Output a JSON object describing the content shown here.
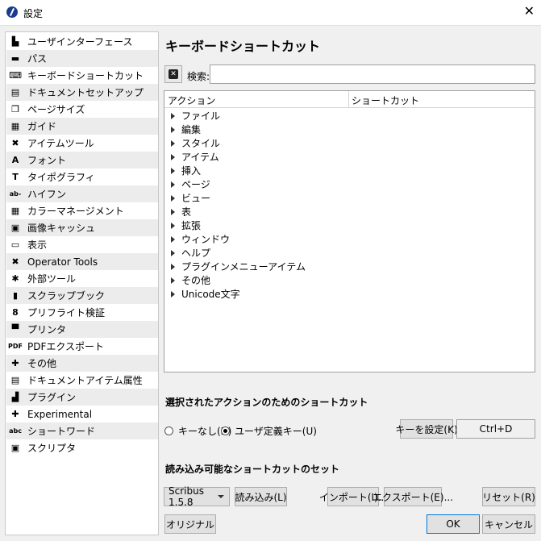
{
  "window": {
    "title": "設定",
    "close": "✕"
  },
  "sidebar": {
    "items": [
      {
        "label": "ユーザインターフェース",
        "icon": "user-interface-icon",
        "glyph": "▙"
      },
      {
        "label": "パス",
        "icon": "folder-icon",
        "glyph": "▬"
      },
      {
        "label": "キーボードショートカット",
        "icon": "keyboard-icon",
        "glyph": "⌨"
      },
      {
        "label": "ドキュメントセットアップ",
        "icon": "document-setup-icon",
        "glyph": "▤"
      },
      {
        "label": "ページサイズ",
        "icon": "page-size-icon",
        "glyph": "❐"
      },
      {
        "label": "ガイド",
        "icon": "guides-icon",
        "glyph": "▦"
      },
      {
        "label": "アイテムツール",
        "icon": "tools-icon",
        "glyph": "✖"
      },
      {
        "label": "フォント",
        "icon": "font-icon",
        "glyph": "A"
      },
      {
        "label": "タイポグラフィ",
        "icon": "typography-icon",
        "glyph": "T"
      },
      {
        "label": "ハイフン",
        "icon": "hyphenation-icon",
        "glyph": "ab-"
      },
      {
        "label": "カラーマネージメント",
        "icon": "color-management-icon",
        "glyph": "▦"
      },
      {
        "label": "画像キャッシュ",
        "icon": "image-cache-icon",
        "glyph": "▣"
      },
      {
        "label": "表示",
        "icon": "display-icon",
        "glyph": "▭"
      },
      {
        "label": "Operator Tools",
        "icon": "operator-tools-icon",
        "glyph": "✖"
      },
      {
        "label": "外部ツール",
        "icon": "external-tools-icon",
        "glyph": "✱"
      },
      {
        "label": "スクラップブック",
        "icon": "scrapbook-icon",
        "glyph": "▮"
      },
      {
        "label": "プリフライト検証",
        "icon": "preflight-icon",
        "glyph": "8"
      },
      {
        "label": "プリンタ",
        "icon": "printer-icon",
        "glyph": "▀"
      },
      {
        "label": "PDFエクスポート",
        "icon": "pdf-export-icon",
        "glyph": "PDF"
      },
      {
        "label": "その他",
        "icon": "misc-icon",
        "glyph": "✚"
      },
      {
        "label": "ドキュメントアイテム属性",
        "icon": "document-item-attributes-icon",
        "glyph": "▤"
      },
      {
        "label": "プラグイン",
        "icon": "plugins-icon",
        "glyph": "▟"
      },
      {
        "label": "Experimental",
        "icon": "experimental-icon",
        "glyph": "✚"
      },
      {
        "label": "ショートワード",
        "icon": "short-words-icon",
        "glyph": "abc"
      },
      {
        "label": "スクリプタ",
        "icon": "scripter-icon",
        "glyph": "▣"
      }
    ]
  },
  "main": {
    "heading": "キーボードショートカット",
    "search_label": "検索:",
    "search_value": "",
    "columns": {
      "action": "アクション",
      "shortcut": "ショートカット"
    },
    "tree": [
      "ファイル",
      "編集",
      "スタイル",
      "アイテム",
      "挿入",
      "ページ",
      "ビュー",
      "表",
      "拡張",
      "ウィンドウ",
      "ヘルプ",
      "プラグインメニューアイテム",
      "その他",
      "Unicode文字"
    ],
    "selected_section": "選択されたアクションのためのショートカット",
    "radio_none": "キーなし(N)",
    "radio_user": "ユーザ定義キー(U)",
    "set_key": "キーを設定(K)",
    "current_shortcut": "Ctrl+D",
    "sets_section": "読み込み可能なショートカットのセット",
    "set_combo": "Scribus 1.5.8",
    "load": "読み込み(L)",
    "import": "インポート(I)...",
    "export": "エクスポート(E)...",
    "reset": "リセット(R)",
    "original": "オリジナル",
    "ok": "OK",
    "cancel": "キャンセル"
  }
}
